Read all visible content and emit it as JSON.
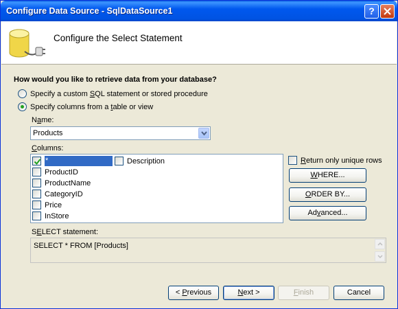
{
  "window": {
    "title": "Configure Data Source - SqlDataSource1",
    "help_icon": "help-icon",
    "close_icon": "close-icon"
  },
  "header": {
    "title": "Configure the Select Statement",
    "icon": "database-icon"
  },
  "question": "How would you like to retrieve data from your database?",
  "options": [
    {
      "label": "Specify a custom SQL statement or stored procedure",
      "selected": false
    },
    {
      "label": "Specify columns from a table or view",
      "selected": true
    }
  ],
  "name_field": {
    "label": "Name:",
    "value": "Products"
  },
  "columns": {
    "label": "Columns:",
    "items": [
      {
        "label": "*",
        "checked": true,
        "selected": true
      },
      {
        "label": "ProductID",
        "checked": false
      },
      {
        "label": "ProductName",
        "checked": false
      },
      {
        "label": "CategoryID",
        "checked": false
      },
      {
        "label": "Price",
        "checked": false
      },
      {
        "label": "InStore",
        "checked": false
      },
      {
        "label": "Description",
        "checked": false
      }
    ]
  },
  "unique_rows": {
    "label": "Return only unique rows",
    "checked": false
  },
  "side_buttons": {
    "where": "WHERE...",
    "order_by": "ORDER BY...",
    "advanced": "Advanced..."
  },
  "select_statement": {
    "label": "SELECT statement:",
    "value": "SELECT * FROM [Products]"
  },
  "footer_buttons": {
    "previous": "< Previous",
    "next": "Next >",
    "finish": "Finish",
    "cancel": "Cancel"
  },
  "colors": {
    "titlebar": "#0058ee",
    "dialog_bg": "#ece9d8",
    "selection": "#316ac5",
    "radio_dot": "#21a121"
  }
}
